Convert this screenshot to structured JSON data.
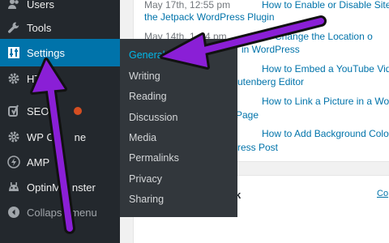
{
  "sidebar": {
    "items": [
      {
        "label": "Users",
        "icon": "users-icon"
      },
      {
        "label": "Tools",
        "icon": "wrench-icon"
      },
      {
        "label": "Settings",
        "icon": "settings-sliders-icon"
      },
      {
        "label": "HT",
        "icon": "gear-icon"
      },
      {
        "label": "SEO",
        "icon": "yoast-seo-icon"
      },
      {
        "label": "WP Cl",
        "label_tail": "ne",
        "icon": "gear-icon"
      },
      {
        "label": "AMP",
        "icon": "amp-lightning-icon"
      },
      {
        "label": "OptinM",
        "label_tail": "nster",
        "icon": "optinmonster-icon"
      }
    ],
    "collapse": {
      "label": "Collapse menu",
      "icon": "collapse-arrow-icon"
    }
  },
  "submenu": {
    "items": [
      {
        "label": "General",
        "current": true
      },
      {
        "label": "Writing"
      },
      {
        "label": "Reading"
      },
      {
        "label": "Discussion"
      },
      {
        "label": "Media"
      },
      {
        "label": "Permalinks"
      },
      {
        "label": "Privacy"
      },
      {
        "label": "Sharing"
      }
    ]
  },
  "activity": {
    "rows": [
      {
        "date": "May 17th, 12:55 pm",
        "title_line1": "How to Enable or Disable Siteı",
        "title_line2": "the Jetpack WordPress Plugin"
      },
      {
        "date": "May 14th, 1",
        "date_tail": "4 pm",
        "title_line1": "t to Change the Location o",
        "title_line2": "in WordPress"
      },
      {
        "date": "",
        "title_line1": "How to Embed a YouTube Vid",
        "title_line2": "utenberg Editor"
      },
      {
        "date": "",
        "title_line1": "How to Link a Picture in a Wo",
        "title_line2": "Page"
      },
      {
        "date": "",
        "title_line1": "How to Add Background Colo",
        "title_line2": "ress Post"
      }
    ]
  },
  "bottom_widget": {
    "title": "k",
    "link": "Co"
  },
  "colors": {
    "sidebar_bg": "#23282d",
    "active_bg": "#0073aa",
    "submenu_bg": "#32373c",
    "submenu_current": "#00b9eb",
    "link": "#0073aa",
    "arrow": "#8a1fd6"
  }
}
